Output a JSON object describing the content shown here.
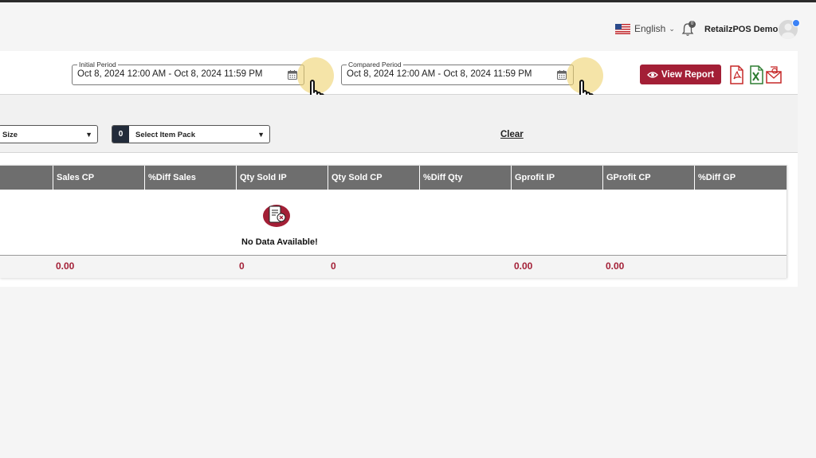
{
  "header": {
    "language": "English",
    "notification_count": "0",
    "user_name": "RetailzPOS Demo"
  },
  "filters": {
    "initial_period": {
      "label": "Initial Period",
      "value": "Oct 8, 2024 12:00 AM - Oct 8, 2024 11:59 PM"
    },
    "compared_period": {
      "label": "Compared Period",
      "value": "Oct 8, 2024 12:00 AM - Oct 8, 2024 11:59 PM"
    },
    "view_report_label": "View Report",
    "export_icons": [
      "pdf-export-icon",
      "excel-export-icon",
      "email-export-icon"
    ]
  },
  "selects": {
    "size_label": "Size",
    "item_pack_count": "0",
    "item_pack_label": "Select Item Pack",
    "clear_label": "Clear"
  },
  "table": {
    "columns": [
      "Sales CP",
      "%Diff Sales",
      "Qty Sold IP",
      "Qty Sold CP",
      "%Diff Qty",
      "Gprofit IP",
      "GProfit CP",
      "%Diff GP"
    ],
    "empty_message": "No Data Available!",
    "totals": {
      "sales_cp": "0.00",
      "qty_sold_ip": "0",
      "qty_sold_cp": "0",
      "gprofit_ip": "0.00",
      "gprofit_cp": "0.00"
    }
  },
  "colors": {
    "accent": "#a31f36",
    "header_bg": "#6e6e6e",
    "highlight": "#eed26e"
  }
}
